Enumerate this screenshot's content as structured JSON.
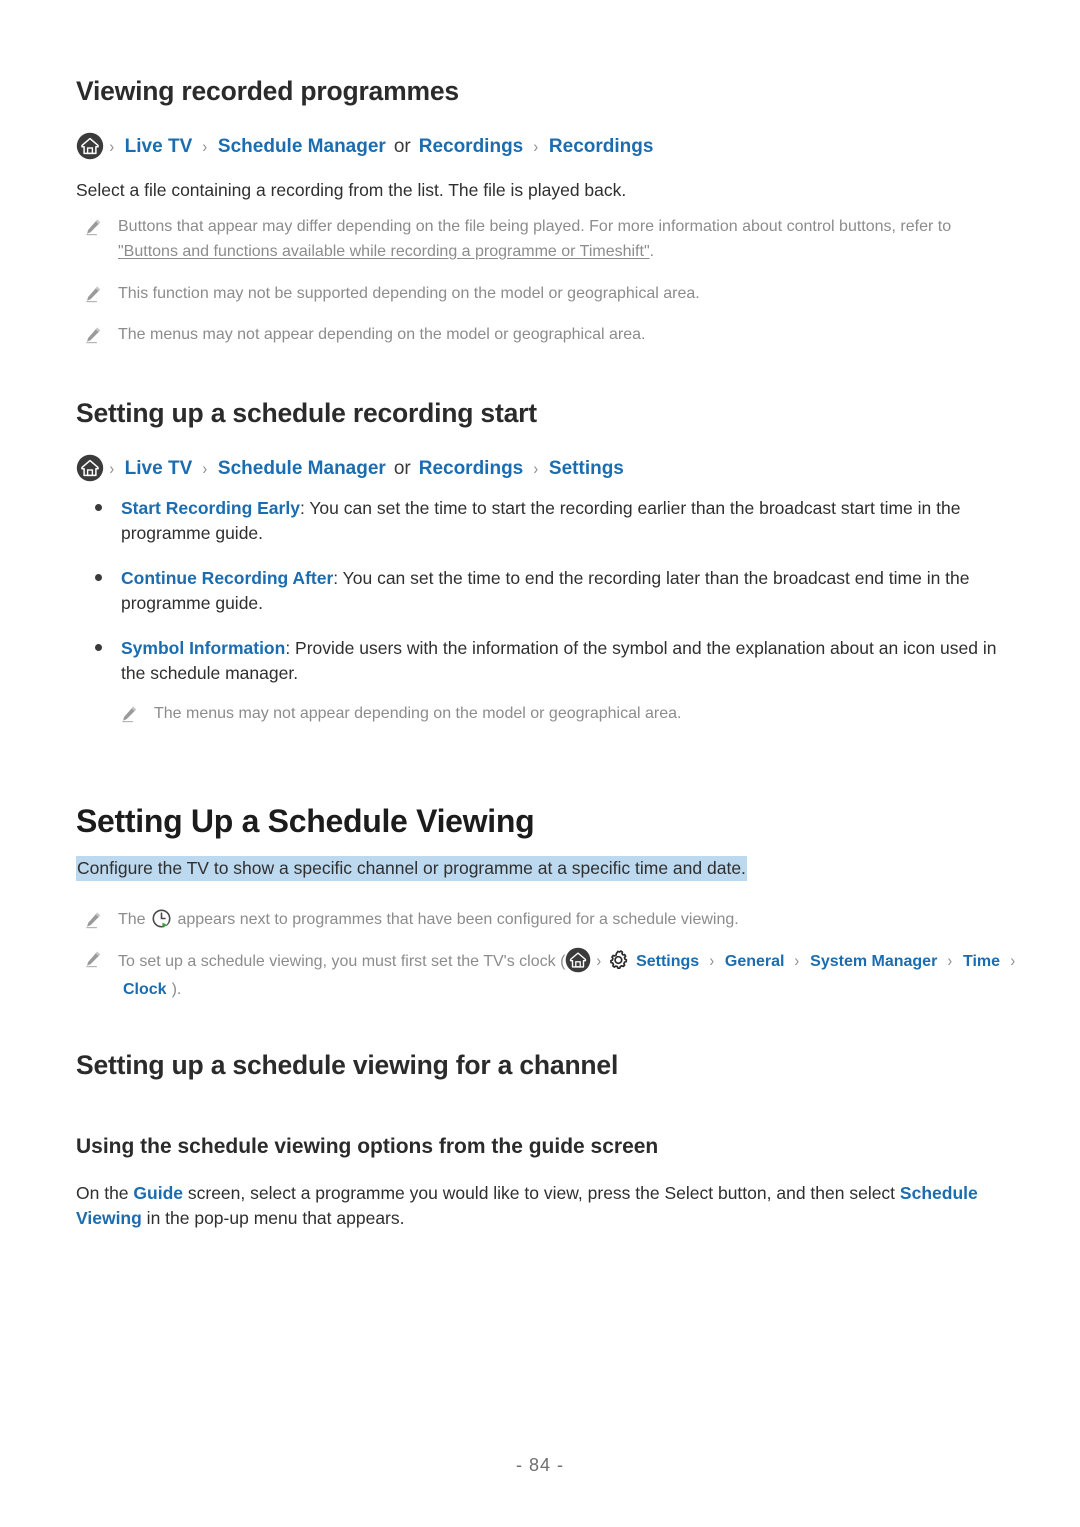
{
  "document": {
    "page_number": "- 84 -"
  },
  "sections": {
    "viewing_recorded": {
      "heading": "Viewing recorded programmes",
      "breadcrumb": [
        {
          "type": "home-icon",
          "label": "Home"
        },
        {
          "type": "chev",
          "label": "›"
        },
        {
          "type": "link",
          "label": "Live TV"
        },
        {
          "type": "chev",
          "label": "›"
        },
        {
          "type": "link",
          "label": "Schedule Manager"
        },
        {
          "type": "plain",
          "label": "or"
        },
        {
          "type": "link",
          "label": "Recordings"
        },
        {
          "type": "chev",
          "label": "›"
        },
        {
          "type": "link",
          "label": "Recordings"
        }
      ],
      "intro": "Select a file containing a recording from the list. The file is played back.",
      "notes": [
        {
          "text_before": "Buttons that appear may differ depending on the file being played. For more information about control buttons, refer to ",
          "xref": "\"Buttons and functions available while recording a programme or Timeshift\"",
          "text_after": "."
        },
        {
          "text_before": "This function may not be supported depending on the model or geographical area.",
          "xref": "",
          "text_after": ""
        },
        {
          "text_before": "The menus may not appear depending on the model or geographical area.",
          "xref": "",
          "text_after": ""
        }
      ]
    },
    "schedule_recording_start": {
      "heading": "Setting up a schedule recording start",
      "breadcrumb": [
        {
          "type": "home-icon",
          "label": "Home"
        },
        {
          "type": "chev",
          "label": "›"
        },
        {
          "type": "link",
          "label": "Live TV"
        },
        {
          "type": "chev",
          "label": "›"
        },
        {
          "type": "link",
          "label": "Schedule Manager"
        },
        {
          "type": "plain",
          "label": "or"
        },
        {
          "type": "link",
          "label": "Recordings"
        },
        {
          "type": "chev",
          "label": "›"
        },
        {
          "type": "link",
          "label": "Settings"
        }
      ],
      "bullets": [
        {
          "term": "Start Recording Early",
          "description": ": You can set the time to start the recording earlier than the broadcast start time in the programme guide."
        },
        {
          "term": "Continue Recording After",
          "description": ": You can set the time to end the recording later than the broadcast end time in the programme guide."
        },
        {
          "term": "Symbol Information",
          "description": ": Provide users with the information of the symbol and the explanation about an icon used in the schedule manager."
        }
      ],
      "sub_note": "The menus may not appear depending on the model or geographical area."
    },
    "setting_up_schedule_viewing": {
      "heading": "Setting Up a Schedule Viewing",
      "highlighted_intro": "Configure the TV to show a specific channel or programme at a specific time and date.",
      "note_clock": {
        "before": "The ",
        "icon": "schedule-viewing-clock-icon",
        "after": " appears next to programmes that have been configured for a schedule viewing."
      },
      "note_clock_setup": {
        "before": "To set up a schedule viewing, you must first set the TV's clock (",
        "path": [
          {
            "type": "home-icon",
            "label": "Home"
          },
          {
            "type": "chev",
            "label": "›"
          },
          {
            "type": "gear-icon",
            "label": "Settings gear"
          },
          {
            "type": "link",
            "label": "Settings"
          },
          {
            "type": "chev",
            "label": "›"
          },
          {
            "type": "link",
            "label": "General"
          },
          {
            "type": "chev",
            "label": "›"
          },
          {
            "type": "link",
            "label": "System Manager"
          },
          {
            "type": "chev",
            "label": "›"
          },
          {
            "type": "link",
            "label": "Time"
          },
          {
            "type": "chev",
            "label": "›"
          },
          {
            "type": "link",
            "label": "Clock"
          }
        ],
        "after": ")."
      }
    },
    "schedule_viewing_channel": {
      "heading": "Setting up a schedule viewing for a channel",
      "subheading": "Using the schedule viewing options from the guide screen",
      "paragraph": {
        "p1": "On the ",
        "link1": "Guide",
        "p2": " screen, select a programme you would like to view, press the Select button, and then select ",
        "link2": "Schedule Viewing",
        "p3": " in the pop-up menu that appears."
      }
    }
  },
  "colors": {
    "link_blue": "#1c6cb0",
    "note_gray": "#8c8c8c",
    "highlight_blue": "#bcd9ef",
    "body_text": "#2f2f2f",
    "icon_dark": "#3b3b3b",
    "play_green": "#3a9e3a"
  }
}
